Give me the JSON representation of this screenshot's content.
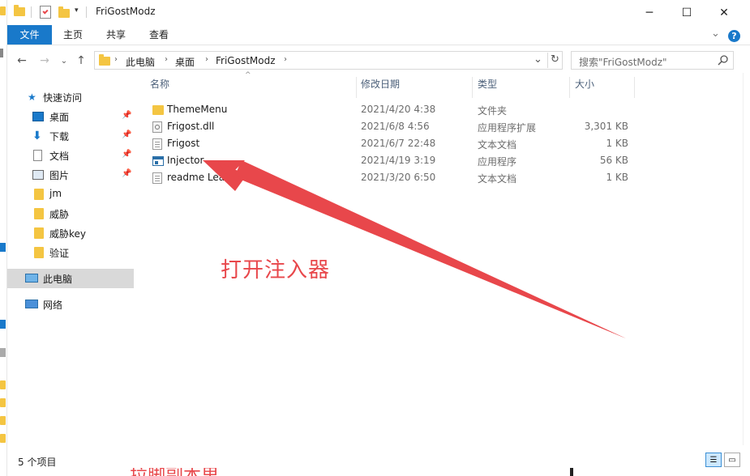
{
  "window": {
    "title": "FriGostModz",
    "minimize_glyph": "─",
    "maximize_glyph": "☐",
    "close_glyph": "✕"
  },
  "ribbon": {
    "tabs": [
      "文件",
      "主页",
      "共享",
      "查看"
    ],
    "help_glyph": "?",
    "expand_glyph": "⌄"
  },
  "nav": {
    "back_glyph": "←",
    "forward_glyph": "→",
    "recent_glyph": "⌄",
    "up_glyph": "↑",
    "breadcrumb": [
      "此电脑",
      "桌面",
      "FriGostModz"
    ],
    "refresh_glyph": "↻",
    "dropdown_glyph": "⌄"
  },
  "search": {
    "placeholder": "搜索\"FriGostModz\"",
    "icon": "search-icon"
  },
  "sidebar": {
    "quick_access": "快速访问",
    "items": [
      {
        "label": "桌面",
        "icon": "desktop-icon",
        "pinned": true
      },
      {
        "label": "下载",
        "icon": "download-icon",
        "pinned": true
      },
      {
        "label": "文档",
        "icon": "document-icon",
        "pinned": true
      },
      {
        "label": "图片",
        "icon": "picture-icon",
        "pinned": true
      },
      {
        "label": "jm",
        "icon": "folder-icon",
        "pinned": false
      },
      {
        "label": "威胁",
        "icon": "folder-icon",
        "pinned": false
      },
      {
        "label": "威胁key",
        "icon": "folder-icon",
        "pinned": false
      },
      {
        "label": "验证",
        "icon": "folder-icon",
        "pinned": false
      }
    ],
    "this_pc": "此电脑",
    "network": "网络"
  },
  "columns": {
    "name": "名称",
    "date": "修改日期",
    "type": "类型",
    "size": "大小"
  },
  "files": [
    {
      "name": "ThemeMenu",
      "date": "2021/4/20 4:38",
      "type": "文件夹",
      "size": "",
      "icon": "folder-icon"
    },
    {
      "name": "Frigost.dll",
      "date": "2021/6/8 4:56",
      "type": "应用程序扩展",
      "size": "3,301 KB",
      "icon": "dll-icon"
    },
    {
      "name": "Frigost",
      "date": "2021/6/7 22:48",
      "type": "文本文档",
      "size": "1 KB",
      "icon": "text-file-icon"
    },
    {
      "name": "Injector",
      "date": "2021/4/19 3:19",
      "type": "应用程序",
      "size": "56 KB",
      "icon": "exe-icon"
    },
    {
      "name": "readme  Lea me",
      "date": "2021/3/20 6:50",
      "type": "文本文档",
      "size": "1 KB",
      "icon": "text-file-icon"
    }
  ],
  "status": {
    "item_count": "5 个项目"
  },
  "annotation": {
    "text": "打开注入器",
    "color": "#e8474b",
    "cut_text": "拉脚副本里"
  },
  "colors": {
    "accent": "#1979ca",
    "selection": "#cce8ff",
    "folder": "#f4c542"
  }
}
